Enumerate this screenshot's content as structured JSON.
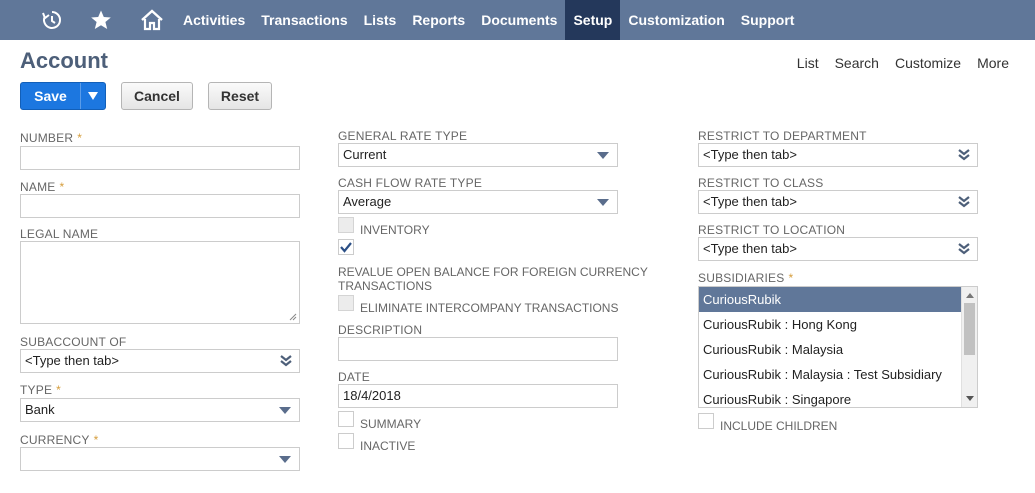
{
  "nav": {
    "icons": [
      "recent-icon",
      "star-icon",
      "home-icon"
    ],
    "items": [
      {
        "label": "Activities"
      },
      {
        "label": "Transactions"
      },
      {
        "label": "Lists"
      },
      {
        "label": "Reports"
      },
      {
        "label": "Documents"
      },
      {
        "label": "Setup"
      },
      {
        "label": "Customization"
      },
      {
        "label": "Support"
      }
    ],
    "active": "Setup"
  },
  "header": {
    "title": "Account",
    "links": [
      "List",
      "Search",
      "Customize",
      "More"
    ]
  },
  "buttons": {
    "save": "Save",
    "cancel": "Cancel",
    "reset": "Reset"
  },
  "left": {
    "number_label": "NUMBER",
    "number_value": "",
    "name_label": "NAME",
    "name_value": "",
    "legal_name_label": "LEGAL NAME",
    "subaccount_label": "SUBACCOUNT OF",
    "subaccount_value": "<Type then tab>",
    "type_label": "TYPE",
    "type_value": "Bank",
    "currency_label": "CURRENCY",
    "currency_value": ""
  },
  "middle": {
    "general_rate_label": "GENERAL RATE TYPE",
    "general_rate_value": "Current",
    "cash_flow_label": "CASH FLOW RATE TYPE",
    "cash_flow_value": "Average",
    "inventory_label": "INVENTORY",
    "inventory_checked": false,
    "revalue_label": "REVALUE OPEN BALANCE FOR FOREIGN CURRENCY TRANSACTIONS",
    "revalue_checked": true,
    "eliminate_label": "ELIMINATE INTERCOMPANY TRANSACTIONS",
    "eliminate_checked": false,
    "description_label": "DESCRIPTION",
    "description_value": "",
    "date_label": "DATE",
    "date_value": "18/4/2018",
    "summary_label": "SUMMARY",
    "summary_checked": false,
    "inactive_label": "INACTIVE",
    "inactive_checked": false
  },
  "right": {
    "department_label": "RESTRICT TO DEPARTMENT",
    "department_value": "<Type then tab>",
    "class_label": "RESTRICT TO CLASS",
    "class_value": "<Type then tab>",
    "location_label": "RESTRICT TO LOCATION",
    "location_value": "<Type then tab>",
    "subsidiaries_label": "SUBSIDIARIES",
    "subsidiaries": [
      "CuriousRubik",
      "CuriousRubik : Hong Kong",
      "CuriousRubik : Malaysia",
      "CuriousRubik : Malaysia : Test Subsidiary",
      "CuriousRubik : Singapore"
    ],
    "subsidiaries_selected": "CuriousRubik",
    "include_children_label": "INCLUDE CHILDREN",
    "include_children_checked": false
  },
  "colors": {
    "nav_bg": "#607799",
    "nav_active": "#24385b",
    "save_blue": "#1c77e0",
    "required": "#d59d3c"
  }
}
